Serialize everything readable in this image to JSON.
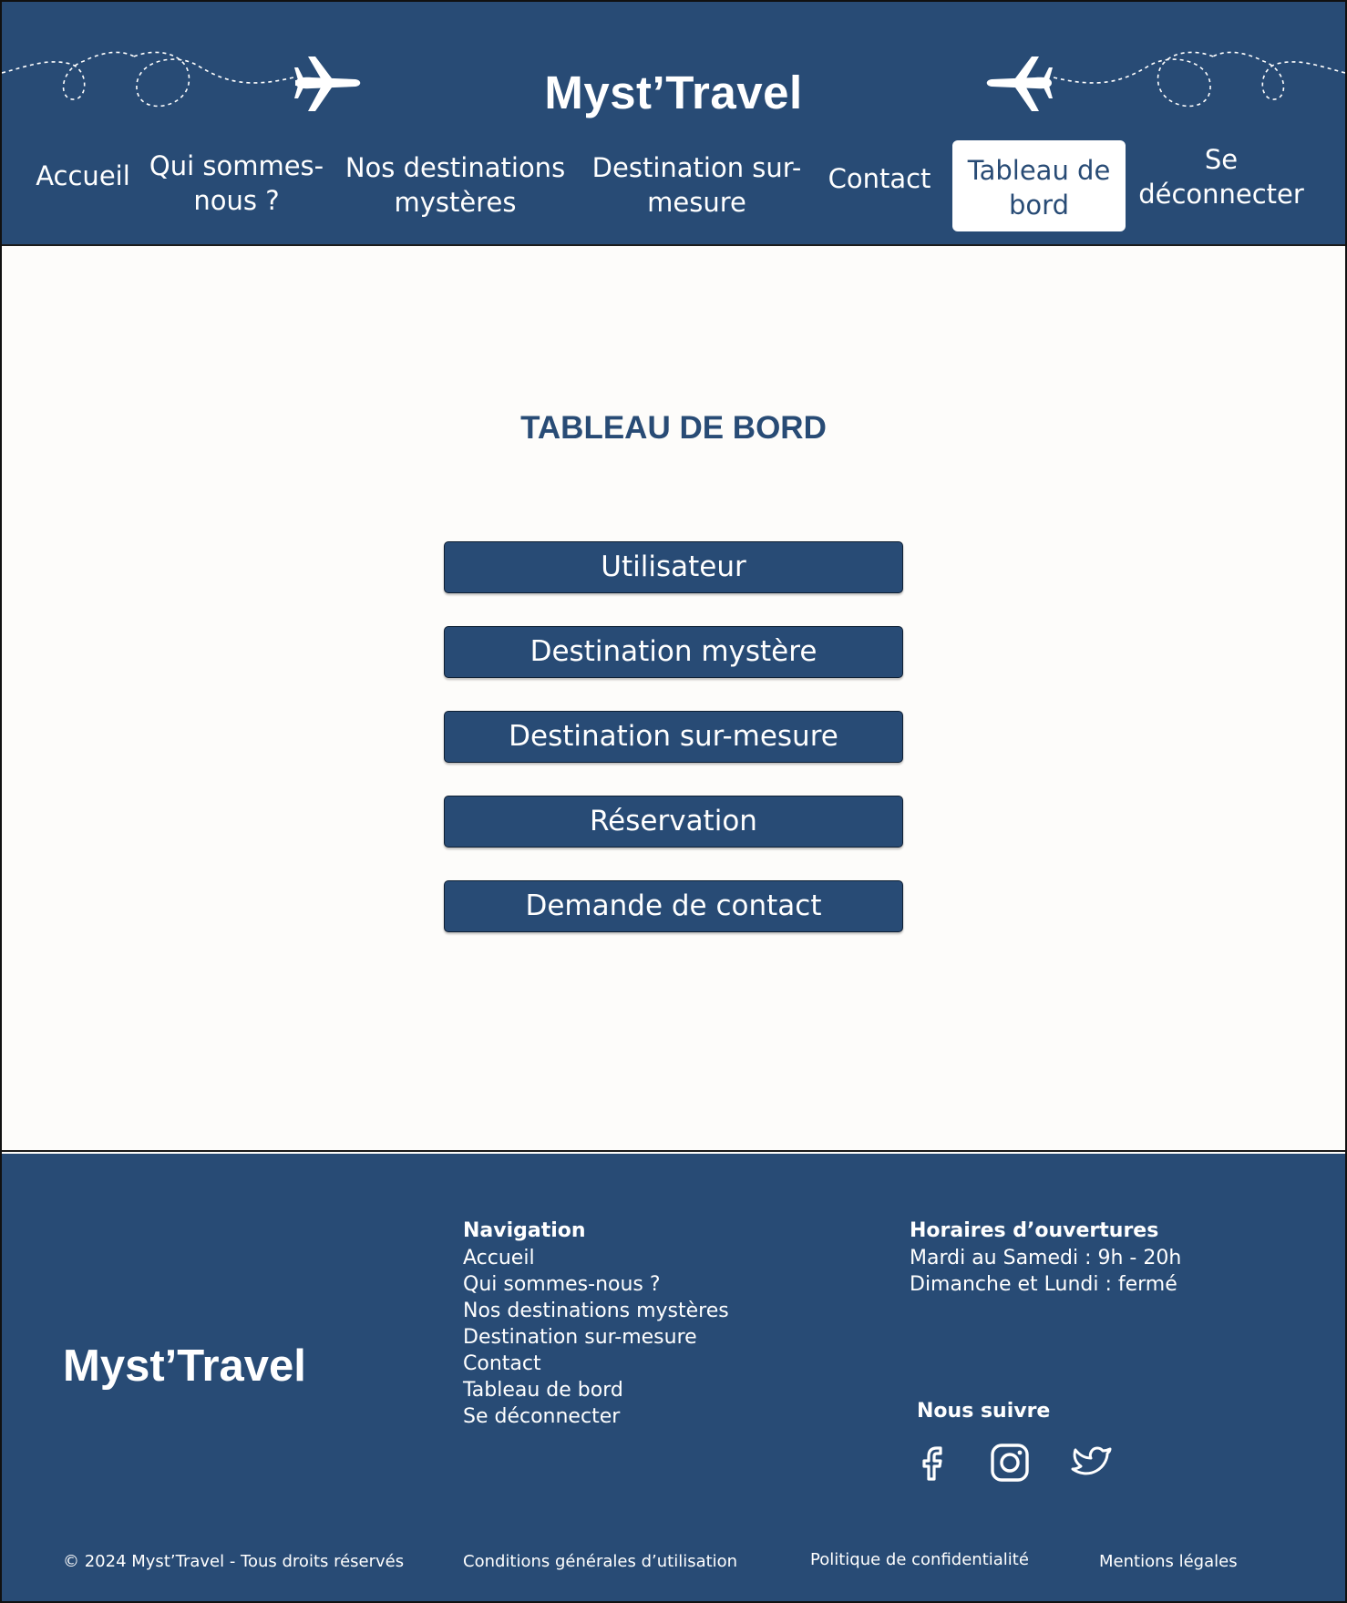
{
  "header": {
    "brand": "Myst’Travel",
    "nav": [
      {
        "line1": "Accueil",
        "line2": ""
      },
      {
        "line1": "Qui sommes-",
        "line2": "nous ?"
      },
      {
        "line1": "Nos destinations",
        "line2": "mystères"
      },
      {
        "line1": "Destination sur-",
        "line2": "mesure"
      },
      {
        "line1": "Contact",
        "line2": ""
      },
      {
        "line1": "Tableau de",
        "line2": "bord"
      },
      {
        "line1": "Se",
        "line2": "déconnecter"
      }
    ]
  },
  "main": {
    "title": "TABLEAU DE BORD",
    "buttons": [
      "Utilisateur",
      "Destination mystère",
      "Destination sur-mesure",
      "Réservation",
      "Demande de contact"
    ]
  },
  "footer": {
    "brand": "Myst’Travel",
    "navigation_heading": "Navigation",
    "navigation_links": [
      "Accueil",
      "Qui sommes-nous ?",
      "Nos destinations mystères",
      "Destination sur-mesure",
      "Contact",
      "Tableau de bord",
      "Se déconnecter"
    ],
    "hours_heading": "Horaires d’ouvertures",
    "hours_lines": [
      "Mardi au Samedi : 9h - 20h",
      "Dimanche et Lundi : fermé"
    ],
    "follow_heading": "Nous suivre",
    "social_icons": [
      "facebook-icon",
      "instagram-icon",
      "twitter-icon"
    ],
    "copyright": "© 2024 Myst’Travel - Tous droits réservés",
    "cgu": "Conditions générales d’utilisation",
    "privacy": "Politique de confidentialité",
    "legal": "Mentions légales"
  },
  "colors": {
    "primary": "#284b75",
    "background": "#fdfcfa",
    "text_light": "#ffffff"
  }
}
